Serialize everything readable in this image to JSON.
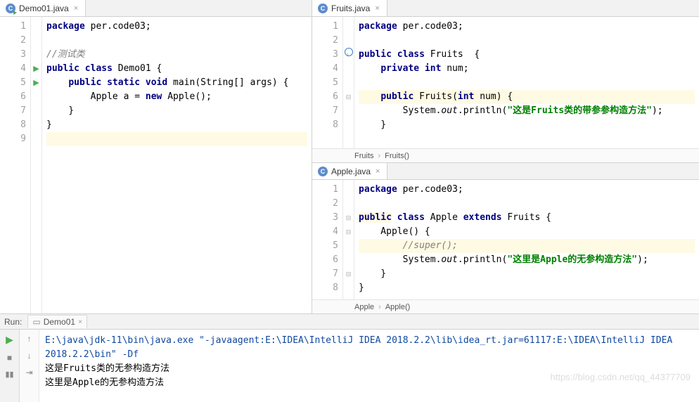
{
  "tabs": {
    "left": "Demo01.java",
    "right_top": "Fruits.java",
    "right_bottom": "Apple.java"
  },
  "demo01": {
    "lines": [
      "1",
      "2",
      "3",
      "4",
      "5",
      "6",
      "7",
      "8",
      "9"
    ],
    "code": {
      "pkg_kw": "package",
      "pkg_val": " per.code03;",
      "comment": "//测试类",
      "cls": "public class",
      "cls_name": " Demo01 {",
      "main_sig": "public static void",
      "main_name": " main(String[] args) {",
      "body": "        Apple a = ",
      "new_kw": "new",
      "new_call": " Apple();",
      "rb1": "    }",
      "rb2": "}"
    }
  },
  "fruits": {
    "lines": [
      "1",
      "2",
      "3",
      "4",
      "5",
      "6",
      "7",
      "8"
    ],
    "code": {
      "pkg_kw": "package",
      "pkg_val": " per.code03;",
      "cls": "public class",
      "cls_name": " Fruits  {",
      "field": "private int",
      "field_name": " num;",
      "ctor": "public",
      "ctor_name": " Fruits(",
      "int_kw": "int",
      "ctor_rest": " num) {",
      "print_pre": "        System.",
      "out": "out",
      "print_mid": ".println(",
      "str": "\"这是Fruits类的带参参构造方法\"",
      "print_end": ");",
      "rb1": "    }",
      "rb2": "}"
    },
    "breadcrumb": {
      "a": "Fruits",
      "b": "Fruits()"
    }
  },
  "apple": {
    "lines": [
      "1",
      "2",
      "3",
      "4",
      "5",
      "6",
      "7",
      "8"
    ],
    "code": {
      "pkg_kw": "package",
      "pkg_val": " per.code03;",
      "cls": "public",
      "cls_kw2": " class",
      "cls_name": " Apple ",
      "extends": "extends",
      "parent": " Fruits {",
      "ctor": "    Apple() {",
      "super": "        //super();",
      "print_pre": "        System.",
      "out": "out",
      "print_mid": ".println(",
      "str": "\"这里是Apple的无参构造方法\"",
      "print_end": ");",
      "rb1": "    }",
      "rb2": "}"
    },
    "breadcrumb": {
      "a": "Apple",
      "b": "Apple()"
    }
  },
  "run": {
    "label": "Run:",
    "tab": "Demo01",
    "cmd": "E:\\java\\jdk-11\\bin\\java.exe \"-javaagent:E:\\IDEA\\IntelliJ IDEA 2018.2.2\\lib\\idea_rt.jar=61117:E:\\IDEA\\IntelliJ IDEA 2018.2.2\\bin\" -Df",
    "out1": "这是Fruits类的无参构造方法",
    "out2": "这里是Apple的无参构造方法"
  },
  "watermark": "https://blog.csdn.net/qq_44377709"
}
